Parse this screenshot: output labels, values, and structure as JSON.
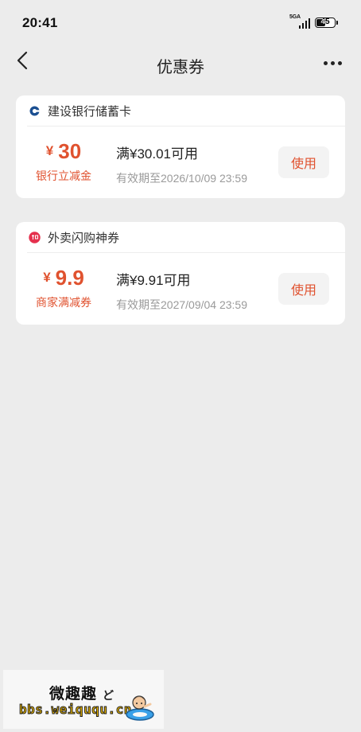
{
  "status_bar": {
    "time": "20:41",
    "network": "5GA",
    "battery": "45"
  },
  "header": {
    "title": "优惠券"
  },
  "coupons": [
    {
      "issuer": "建设银行储蓄卡",
      "currency": "¥",
      "amount": "30",
      "type": "银行立减金",
      "condition": "满¥30.01可用",
      "validity": "有效期至2026/10/09 23:59",
      "action": "使用",
      "icon": "ccb-bank-logo-icon",
      "icon_color": "#1b4f91"
    },
    {
      "issuer": "外卖闪购神券",
      "currency": "¥",
      "amount": "9.9",
      "type": "商家满减券",
      "condition": "满¥9.91可用",
      "validity": "有效期至2027/09/04 23:59",
      "action": "使用",
      "icon": "shen-quan-badge-icon",
      "icon_color": "#e5304d"
    }
  ],
  "watermark": {
    "title": "微趣趣",
    "url": "bbs.weiququ.cn"
  },
  "colors": {
    "accent": "#e0522f",
    "background": "#ececec",
    "card": "#ffffff",
    "muted_text": "#9a9a9a"
  }
}
